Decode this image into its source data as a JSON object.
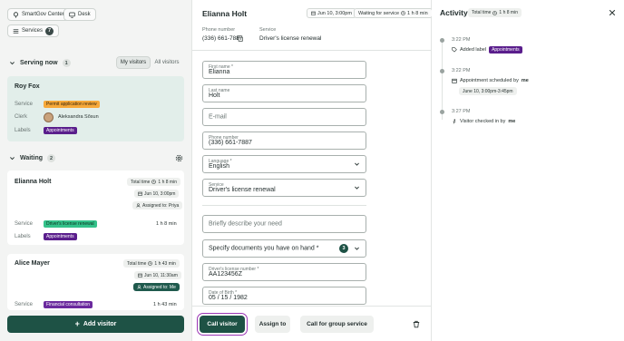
{
  "left": {
    "location_chip": "SmartGov Center",
    "desk_chip": "Desk",
    "services_chip": "Services",
    "services_count": "7",
    "serving": {
      "title": "Serving now",
      "count": "1",
      "tab_my": "My visitors",
      "tab_all": "All visitors",
      "card": {
        "name": "Roy Fox",
        "service_label": "Service",
        "service_value": "Permit application review",
        "clerk_label": "Clerk",
        "clerk_name": "Aleksandra Sõsun",
        "labels_label": "Labels",
        "labels_value": "Appointments"
      }
    },
    "waiting": {
      "title": "Waiting",
      "count": "2",
      "cards": [
        {
          "name": "Elianna Holt",
          "total_time_label": "Total time",
          "total_time": "1 h 8 min",
          "date": "Jun 10, 3:00pm",
          "assigned": "Assigned to: Priya",
          "service_label": "Service",
          "service_value": "Driver's license renewal",
          "wait": "1 h 8 min",
          "labels_label": "Labels",
          "labels_value": "Appointments"
        },
        {
          "name": "Alice Mayer",
          "total_time_label": "Total time",
          "total_time": "1 h 43 min",
          "date": "Jun 10, 11:30am",
          "assigned": "Assigned to: Me",
          "service_label": "Service",
          "service_value": "Financial consultation",
          "wait": "1 h 43 min"
        }
      ]
    },
    "add_visitor": "Add visitor"
  },
  "middle": {
    "title": "Elianna Holt",
    "date_chip": "Jun 10, 3:00pm",
    "status_chip_label": "Waiting for service",
    "status_chip_time": "1 h 8 min",
    "phone_label": "Phone number",
    "phone_value": "(336) 661-7887",
    "service_label": "Service",
    "service_value": "Driver's license renewal",
    "form": {
      "first_name_label": "First name *",
      "first_name": "Elianna",
      "last_name_label": "Last name",
      "last_name": "Holt",
      "email_placeholder": "E-mail",
      "phone_label": "Phone number",
      "phone": "(336) 661-7887",
      "language_label": "Language *",
      "language": "English",
      "service_label": "Service",
      "service": "Driver's license renewal",
      "need_placeholder": "Briefly describe your need",
      "documents_label": "Specify documents you have on hand *",
      "documents_count": "3",
      "license_label": "Driver's license number *",
      "license": "AA123456Z",
      "dob_label": "Date of Birth *",
      "dob": "05 / 15 / 1982"
    },
    "footer": {
      "call_visitor": "Call visitor",
      "assign_to": "Assign to",
      "call_group": "Call for group service"
    }
  },
  "right": {
    "title": "Activity",
    "total_time_label": "Total time",
    "total_time": "1 h 8 min",
    "events": [
      {
        "time": "3:22 PM",
        "text": "Added label",
        "tag": "Appointments"
      },
      {
        "time": "3:22 PM",
        "text": "Appointment scheduled by",
        "by": "me",
        "pill": "June 10, 3:00pm-3:45pm"
      },
      {
        "time": "3:27 PM",
        "text": "Visitor checked in by",
        "by": "me"
      }
    ]
  },
  "colors": {
    "brand": "#1e5245",
    "tag_purple": "#5a1e8c",
    "tag_orange": "#f7a93a",
    "tag_green": "#34c28a",
    "focus_outline": "#9b35b5"
  }
}
